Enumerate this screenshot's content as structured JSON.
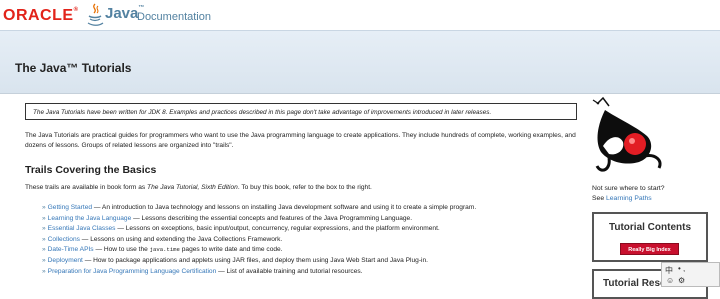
{
  "header": {
    "oracle_logo": "ORACLE",
    "oracle_reg": "®",
    "java_word": "Java",
    "java_tm": "™",
    "doc_label": "Documentation"
  },
  "page_title": "The Java™ Tutorials",
  "notice": "The Java Tutorials have been written for JDK 8. Examples and practices described in this page don't take advantage of improvements introduced in later releases.",
  "intro": "The Java Tutorials are practical guides for programmers who want to use the Java programming language to create applications. They include hundreds of complete, working examples, and dozens of lessons. Groups of related lessons are organized into \"trails\".",
  "section_title": "Trails Covering the Basics",
  "trails_note": {
    "before": "These trails are available in book form as ",
    "book": "The Java Tutorial, Sixth Edition",
    "after": ". To buy this book, refer to the box to the right."
  },
  "trails": [
    {
      "link": "Getting Started",
      "desc": " — An introduction to Java technology and lessons on installing Java development software and using it to create a simple program."
    },
    {
      "link": "Learning the Java Language",
      "desc": " — Lessons describing the essential concepts and features of the Java Programming Language."
    },
    {
      "link": "Essential Java Classes",
      "desc": " — Lessons on exceptions, basic input/output, concurrency, regular expressions, and the platform environment."
    },
    {
      "link": "Collections",
      "desc": " — Lessons on using and extending the Java Collections Framework."
    },
    {
      "link": "Date-Time APIs",
      "desc_a": " — How to use the ",
      "code": "java.time",
      "desc_b": " pages to write date and time code."
    },
    {
      "link": "Deployment",
      "desc": " — How to package applications and applets using JAR files, and deploy them using Java Web Start and Java Plug-in."
    },
    {
      "link": "Preparation for Java Programming Language Certification",
      "desc": " — List of available training and tutorial resources."
    }
  ],
  "sidebar": {
    "not_sure": "Not sure where to start?",
    "see": "See ",
    "learning_paths": "Learning Paths",
    "toc_title": "Tutorial Contents",
    "toc_button": "Really Big Index",
    "resources_title": "Tutorial Resources"
  },
  "ime": {
    "char": "中",
    "dots": "• ,",
    "smile": "☺",
    "gear": "⚙"
  },
  "colors": {
    "oracle_red": "#e2231a",
    "java_blue": "#5382a1",
    "link": "#3577b8",
    "button_red": "#c8102e"
  },
  "icons": [
    "java-cup-icon",
    "duke-mascot",
    "bullet-icon"
  ]
}
